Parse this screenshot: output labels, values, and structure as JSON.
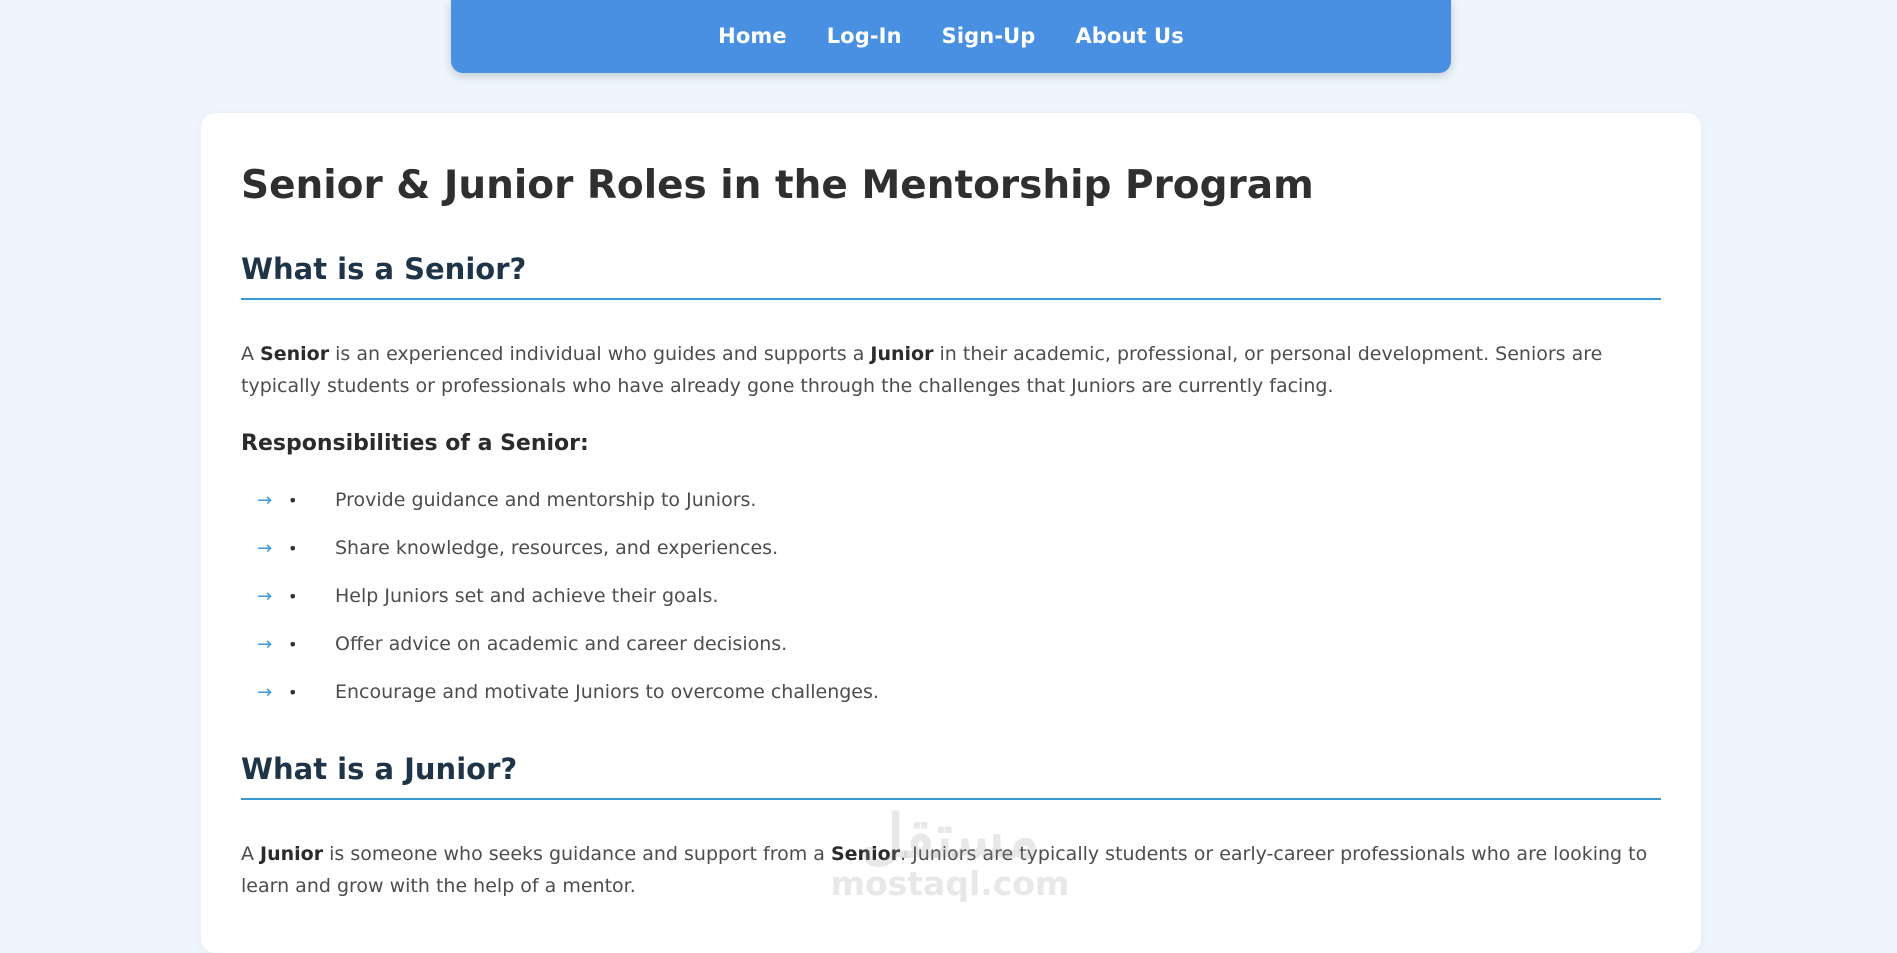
{
  "nav": {
    "items": [
      {
        "label": "Home"
      },
      {
        "label": "Log-In"
      },
      {
        "label": "Sign-Up"
      },
      {
        "label": "About Us"
      }
    ]
  },
  "page": {
    "title": "Senior & Junior Roles in the Mentorship Program",
    "senior": {
      "heading": "What is a Senior?",
      "intro": {
        "p1": "A ",
        "b1": "Senior",
        "p2": " is an experienced individual who guides and supports a ",
        "b2": "Junior",
        "p3": " in their academic, professional, or personal development. Seniors are typically students or professionals who have already gone through the challenges that Juniors are currently facing."
      },
      "responsibilities_title": "Responsibilities of a Senior:",
      "responsibilities": [
        "Provide guidance and mentorship to Juniors.",
        "Share knowledge, resources, and experiences.",
        "Help Juniors set and achieve their goals.",
        "Offer advice on academic and career decisions.",
        "Encourage and motivate Juniors to overcome challenges."
      ]
    },
    "junior": {
      "heading": "What is a Junior?",
      "intro": {
        "p1": "A ",
        "b1": "Junior",
        "p2": " is someone who seeks guidance and support from a ",
        "b2": "Senior",
        "p3": ". Juniors are typically students or early-career professionals who are looking to learn and grow with the help of a mentor."
      }
    }
  },
  "icons": {
    "arrow": "→",
    "bullet": "•"
  },
  "watermark": {
    "script": "مستقل",
    "text": "mostaql.com"
  }
}
